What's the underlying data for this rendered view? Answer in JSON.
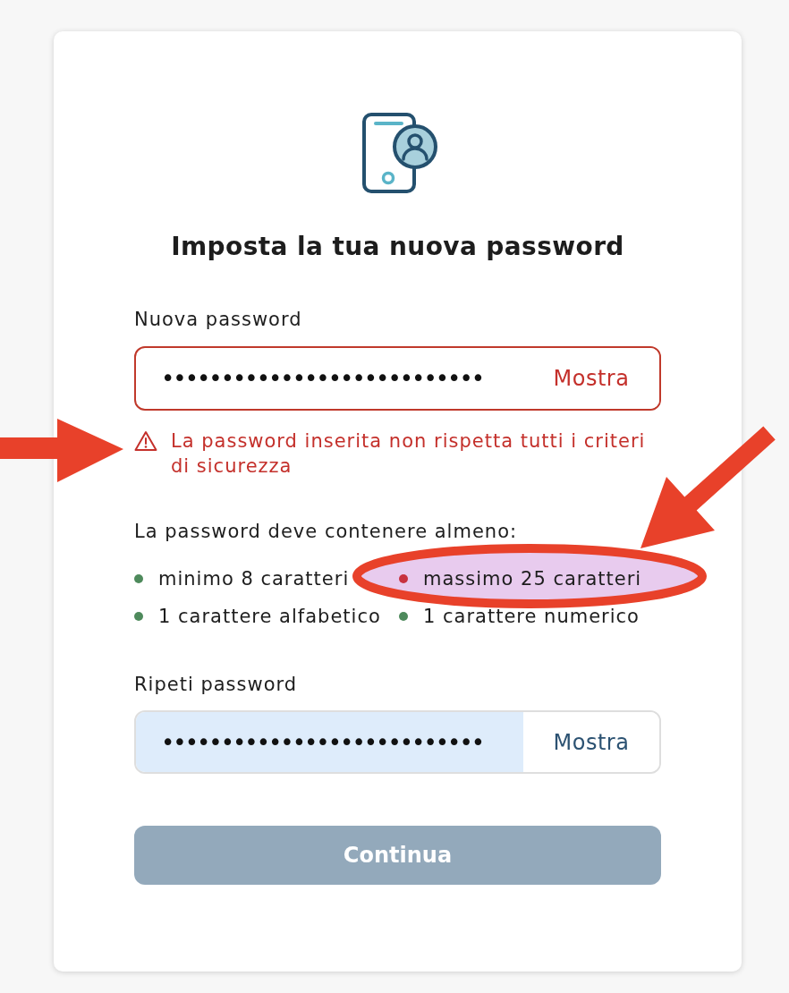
{
  "title": "Imposta la tua nuova password",
  "new_password": {
    "label": "Nuova password",
    "value": "•••••••••••••••••••••••••••",
    "toggle": "Mostra",
    "invalid": true,
    "autofilled": false
  },
  "error": {
    "text": "La password inserita non rispetta tutti i criteri di sicurezza",
    "annotated": true
  },
  "requirements": {
    "heading": "La password deve contenere almeno:",
    "items": [
      {
        "text": "minimo 8 caratteri",
        "met": true,
        "highlighted": false
      },
      {
        "text": "massimo 25 caratteri",
        "met": false,
        "highlighted": true
      },
      {
        "text": "1 carattere alfabetico",
        "met": true,
        "highlighted": false
      },
      {
        "text": "1 carattere numerico",
        "met": true,
        "highlighted": false
      }
    ]
  },
  "repeat_password": {
    "label": "Ripeti password",
    "value": "•••••••••••••••••••••••••••",
    "toggle": "Mostra",
    "invalid": false,
    "autofilled": true
  },
  "continue_button": {
    "label": "Continua",
    "disabled": true
  }
}
